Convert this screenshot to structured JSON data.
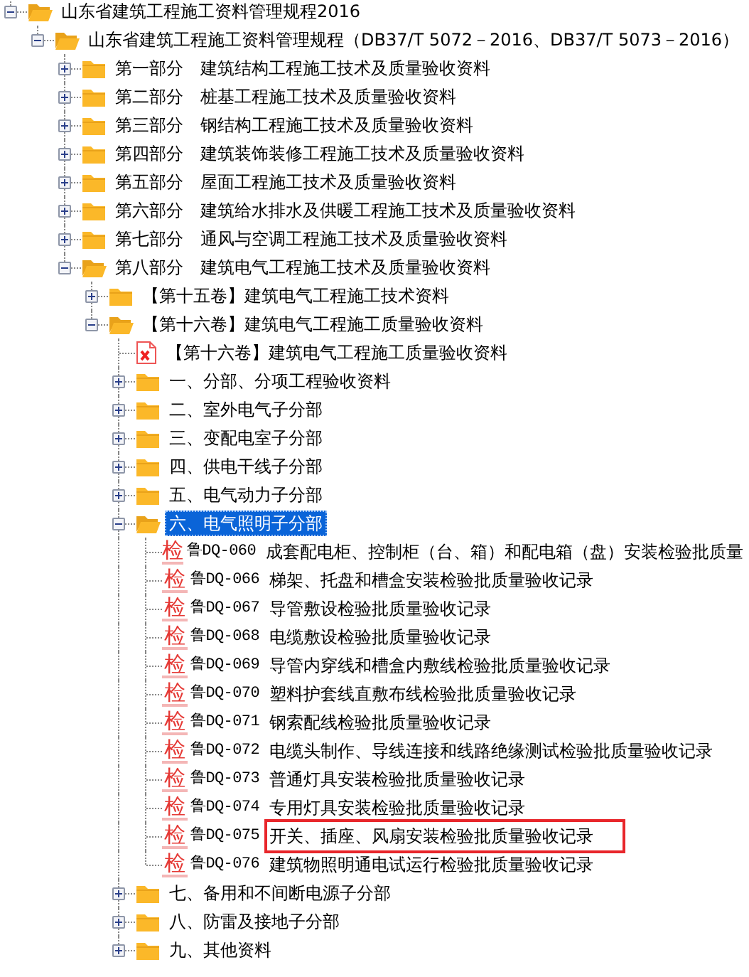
{
  "tree": [
    {
      "kind": "folder",
      "text": "山东省建筑工程施工资料管理规程2016",
      "expanded": true,
      "selected": false,
      "children": [
        {
          "kind": "folder",
          "text": "山东省建筑工程施工资料管理规程（DB37/T 5072－2016、DB37/T 5073－2016）",
          "expanded": true,
          "selected": false,
          "children": [
            {
              "kind": "folder",
              "text": "第一部分　建筑结构工程施工技术及质量验收资料",
              "expanded": false,
              "selected": false
            },
            {
              "kind": "folder",
              "text": "第二部分　桩基工程施工技术及质量验收资料",
              "expanded": false,
              "selected": false
            },
            {
              "kind": "folder",
              "text": "第三部分　钢结构工程施工技术及质量验收资料",
              "expanded": false,
              "selected": false
            },
            {
              "kind": "folder",
              "text": "第四部分　建筑装饰装修工程施工技术及质量验收资料",
              "expanded": false,
              "selected": false
            },
            {
              "kind": "folder",
              "text": "第五部分　屋面工程施工技术及质量验收资料",
              "expanded": false,
              "selected": false
            },
            {
              "kind": "folder",
              "text": "第六部分　建筑给水排水及供暖工程施工技术及质量验收资料",
              "expanded": false,
              "selected": false
            },
            {
              "kind": "folder",
              "text": "第七部分　通风与空调工程施工技术及质量验收资料",
              "expanded": false,
              "selected": false
            },
            {
              "kind": "folder",
              "text": "第八部分　建筑电气工程施工技术及质量验收资料",
              "expanded": true,
              "selected": false,
              "children": [
                {
                  "kind": "folder",
                  "text": "【第十五卷】建筑电气工程施工技术资料",
                  "expanded": false,
                  "selected": false
                },
                {
                  "kind": "folder",
                  "text": "【第十六卷】建筑电气工程施工质量验收资料",
                  "expanded": true,
                  "selected": false,
                  "children": [
                    {
                      "kind": "pdf",
                      "text": "【第十六卷】建筑电气工程施工质量验收资料"
                    },
                    {
                      "kind": "folder",
                      "text": "一、分部、分项工程验收资料",
                      "expanded": false,
                      "selected": false
                    },
                    {
                      "kind": "folder",
                      "text": "二、室外电气子分部",
                      "expanded": false,
                      "selected": false
                    },
                    {
                      "kind": "folder",
                      "text": "三、变配电室子分部",
                      "expanded": false,
                      "selected": false
                    },
                    {
                      "kind": "folder",
                      "text": "四、供电干线子分部",
                      "expanded": false,
                      "selected": false
                    },
                    {
                      "kind": "folder",
                      "text": "五、电气动力子分部",
                      "expanded": false,
                      "selected": false
                    },
                    {
                      "kind": "folder",
                      "text": "六、电气照明子分部",
                      "expanded": true,
                      "selected": true,
                      "children": [
                        {
                          "kind": "check",
                          "badge": "检",
                          "code": "鲁DQ-060",
                          "title": "成套配电柜、控制柜（台、箱）和配电箱（盘）安装检验批质量",
                          "highlighted": false
                        },
                        {
                          "kind": "check",
                          "badge": "检",
                          "code": "鲁DQ-066",
                          "title": "梯架、托盘和槽盒安装检验批质量验收记录",
                          "highlighted": false
                        },
                        {
                          "kind": "check",
                          "badge": "检",
                          "code": "鲁DQ-067",
                          "title": "导管敷设检验批质量验收记录",
                          "highlighted": false
                        },
                        {
                          "kind": "check",
                          "badge": "检",
                          "code": "鲁DQ-068",
                          "title": "电缆敷设检验批质量验收记录",
                          "highlighted": false
                        },
                        {
                          "kind": "check",
                          "badge": "检",
                          "code": "鲁DQ-069",
                          "title": "导管内穿线和槽盒内敷线检验批质量验收记录",
                          "highlighted": false
                        },
                        {
                          "kind": "check",
                          "badge": "检",
                          "code": "鲁DQ-070",
                          "title": "塑料护套线直敷布线检验批质量验收记录",
                          "highlighted": false
                        },
                        {
                          "kind": "check",
                          "badge": "检",
                          "code": "鲁DQ-071",
                          "title": "钢索配线检验批质量验收记录",
                          "highlighted": false
                        },
                        {
                          "kind": "check",
                          "badge": "检",
                          "code": "鲁DQ-072",
                          "title": "电缆头制作、导线连接和线路绝缘测试检验批质量验收记录",
                          "highlighted": false
                        },
                        {
                          "kind": "check",
                          "badge": "检",
                          "code": "鲁DQ-073",
                          "title": "普通灯具安装检验批质量验收记录",
                          "highlighted": false
                        },
                        {
                          "kind": "check",
                          "badge": "检",
                          "code": "鲁DQ-074",
                          "title": "专用灯具安装检验批质量验收记录",
                          "highlighted": false
                        },
                        {
                          "kind": "check",
                          "badge": "检",
                          "code": "鲁DQ-075",
                          "title": "开关、插座、风扇安装检验批质量验收记录",
                          "highlighted": true
                        },
                        {
                          "kind": "check",
                          "badge": "检",
                          "code": "鲁DQ-076",
                          "title": "建筑物照明通电试运行检验批质量验收记录",
                          "highlighted": false
                        }
                      ]
                    },
                    {
                      "kind": "folder",
                      "text": "七、备用和不间断电源子分部",
                      "expanded": false,
                      "selected": false
                    },
                    {
                      "kind": "folder",
                      "text": "八、防雷及接地子分部",
                      "expanded": false,
                      "selected": false
                    },
                    {
                      "kind": "folder",
                      "text": "九、其他资料",
                      "expanded": false,
                      "selected": false
                    }
                  ]
                }
              ]
            }
          ]
        }
      ]
    }
  ]
}
